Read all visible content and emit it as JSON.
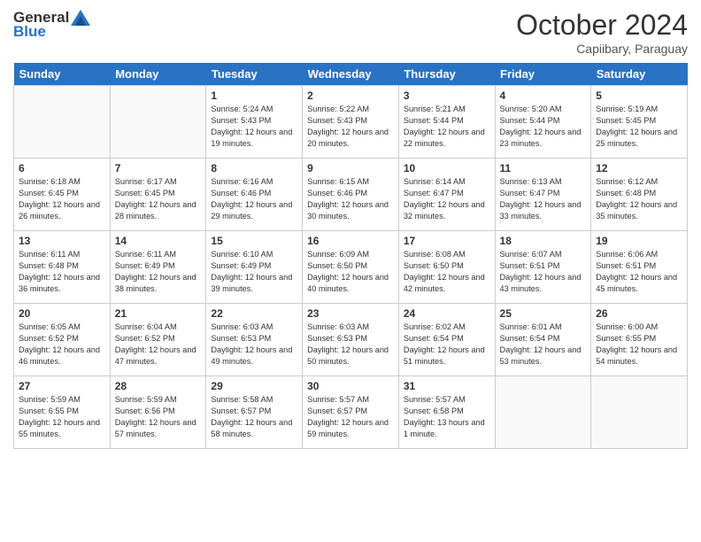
{
  "header": {
    "logo_general": "General",
    "logo_blue": "Blue",
    "month": "October 2024",
    "location": "Capiibary, Paraguay"
  },
  "days_of_week": [
    "Sunday",
    "Monday",
    "Tuesday",
    "Wednesday",
    "Thursday",
    "Friday",
    "Saturday"
  ],
  "weeks": [
    [
      {
        "day": "",
        "content": ""
      },
      {
        "day": "",
        "content": ""
      },
      {
        "day": "1",
        "content": "Sunrise: 5:24 AM\nSunset: 5:43 PM\nDaylight: 12 hours and 19 minutes."
      },
      {
        "day": "2",
        "content": "Sunrise: 5:22 AM\nSunset: 5:43 PM\nDaylight: 12 hours and 20 minutes."
      },
      {
        "day": "3",
        "content": "Sunrise: 5:21 AM\nSunset: 5:44 PM\nDaylight: 12 hours and 22 minutes."
      },
      {
        "day": "4",
        "content": "Sunrise: 5:20 AM\nSunset: 5:44 PM\nDaylight: 12 hours and 23 minutes."
      },
      {
        "day": "5",
        "content": "Sunrise: 5:19 AM\nSunset: 5:45 PM\nDaylight: 12 hours and 25 minutes."
      }
    ],
    [
      {
        "day": "6",
        "content": "Sunrise: 6:18 AM\nSunset: 6:45 PM\nDaylight: 12 hours and 26 minutes."
      },
      {
        "day": "7",
        "content": "Sunrise: 6:17 AM\nSunset: 6:45 PM\nDaylight: 12 hours and 28 minutes."
      },
      {
        "day": "8",
        "content": "Sunrise: 6:16 AM\nSunset: 6:46 PM\nDaylight: 12 hours and 29 minutes."
      },
      {
        "day": "9",
        "content": "Sunrise: 6:15 AM\nSunset: 6:46 PM\nDaylight: 12 hours and 30 minutes."
      },
      {
        "day": "10",
        "content": "Sunrise: 6:14 AM\nSunset: 6:47 PM\nDaylight: 12 hours and 32 minutes."
      },
      {
        "day": "11",
        "content": "Sunrise: 6:13 AM\nSunset: 6:47 PM\nDaylight: 12 hours and 33 minutes."
      },
      {
        "day": "12",
        "content": "Sunrise: 6:12 AM\nSunset: 6:48 PM\nDaylight: 12 hours and 35 minutes."
      }
    ],
    [
      {
        "day": "13",
        "content": "Sunrise: 6:11 AM\nSunset: 6:48 PM\nDaylight: 12 hours and 36 minutes."
      },
      {
        "day": "14",
        "content": "Sunrise: 6:11 AM\nSunset: 6:49 PM\nDaylight: 12 hours and 38 minutes."
      },
      {
        "day": "15",
        "content": "Sunrise: 6:10 AM\nSunset: 6:49 PM\nDaylight: 12 hours and 39 minutes."
      },
      {
        "day": "16",
        "content": "Sunrise: 6:09 AM\nSunset: 6:50 PM\nDaylight: 12 hours and 40 minutes."
      },
      {
        "day": "17",
        "content": "Sunrise: 6:08 AM\nSunset: 6:50 PM\nDaylight: 12 hours and 42 minutes."
      },
      {
        "day": "18",
        "content": "Sunrise: 6:07 AM\nSunset: 6:51 PM\nDaylight: 12 hours and 43 minutes."
      },
      {
        "day": "19",
        "content": "Sunrise: 6:06 AM\nSunset: 6:51 PM\nDaylight: 12 hours and 45 minutes."
      }
    ],
    [
      {
        "day": "20",
        "content": "Sunrise: 6:05 AM\nSunset: 6:52 PM\nDaylight: 12 hours and 46 minutes."
      },
      {
        "day": "21",
        "content": "Sunrise: 6:04 AM\nSunset: 6:52 PM\nDaylight: 12 hours and 47 minutes."
      },
      {
        "day": "22",
        "content": "Sunrise: 6:03 AM\nSunset: 6:53 PM\nDaylight: 12 hours and 49 minutes."
      },
      {
        "day": "23",
        "content": "Sunrise: 6:03 AM\nSunset: 6:53 PM\nDaylight: 12 hours and 50 minutes."
      },
      {
        "day": "24",
        "content": "Sunrise: 6:02 AM\nSunset: 6:54 PM\nDaylight: 12 hours and 51 minutes."
      },
      {
        "day": "25",
        "content": "Sunrise: 6:01 AM\nSunset: 6:54 PM\nDaylight: 12 hours and 53 minutes."
      },
      {
        "day": "26",
        "content": "Sunrise: 6:00 AM\nSunset: 6:55 PM\nDaylight: 12 hours and 54 minutes."
      }
    ],
    [
      {
        "day": "27",
        "content": "Sunrise: 5:59 AM\nSunset: 6:55 PM\nDaylight: 12 hours and 55 minutes."
      },
      {
        "day": "28",
        "content": "Sunrise: 5:59 AM\nSunset: 6:56 PM\nDaylight: 12 hours and 57 minutes."
      },
      {
        "day": "29",
        "content": "Sunrise: 5:58 AM\nSunset: 6:57 PM\nDaylight: 12 hours and 58 minutes."
      },
      {
        "day": "30",
        "content": "Sunrise: 5:57 AM\nSunset: 6:57 PM\nDaylight: 12 hours and 59 minutes."
      },
      {
        "day": "31",
        "content": "Sunrise: 5:57 AM\nSunset: 6:58 PM\nDaylight: 13 hours and 1 minute."
      },
      {
        "day": "",
        "content": ""
      },
      {
        "day": "",
        "content": ""
      }
    ]
  ]
}
